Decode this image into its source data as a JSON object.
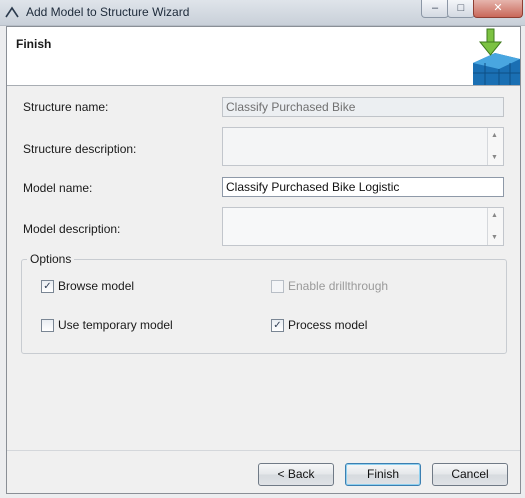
{
  "window": {
    "title": "Add Model to Structure Wizard",
    "controls": {
      "minimize": "–",
      "maximize": "□",
      "close": "✕"
    }
  },
  "header": {
    "title": "Finish",
    "art_icon": "mining-structure-icon"
  },
  "form": {
    "structure_name_label": "Structure name:",
    "structure_name_value": "Classify Purchased Bike",
    "structure_description_label": "Structure description:",
    "structure_description_value": "",
    "model_name_label": "Model name:",
    "model_name_value": "Classify Purchased Bike Logistic",
    "model_description_label": "Model description:",
    "model_description_value": ""
  },
  "options": {
    "legend": "Options",
    "browse_model": {
      "label": "Browse model",
      "checked": true,
      "enabled": true
    },
    "enable_drillthrough": {
      "label": "Enable drillthrough",
      "checked": false,
      "enabled": false
    },
    "use_temporary_model": {
      "label": "Use temporary model",
      "checked": false,
      "enabled": true
    },
    "process_model": {
      "label": "Process model",
      "checked": true,
      "enabled": true
    }
  },
  "buttons": {
    "back": "< Back",
    "finish": "Finish",
    "cancel": "Cancel"
  },
  "glyphs": {
    "check": "✓",
    "up": "▲",
    "down": "▼"
  },
  "colors": {
    "accent_green": "#7cc242",
    "cube_blue": "#1a6fb3"
  }
}
